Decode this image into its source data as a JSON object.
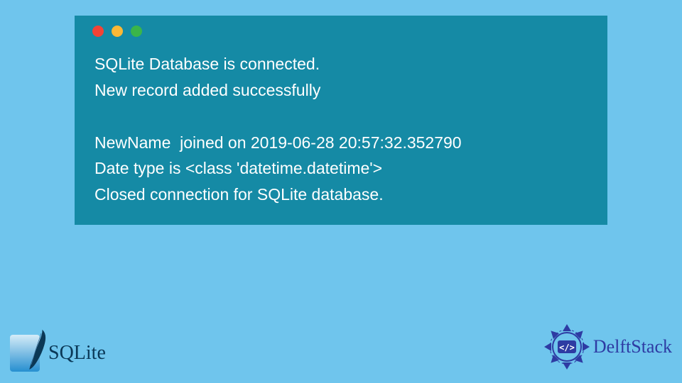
{
  "terminal": {
    "lines": [
      "SQLite Database is connected.",
      "New record added successfully",
      "",
      "NewName  joined on 2019-06-28 20:57:32.352790",
      "Date type is <class 'datetime.datetime'>",
      "Closed connection for SQLite database."
    ]
  },
  "logos": {
    "sqlite": "SQLite",
    "delftstack": "DelftStack"
  },
  "colors": {
    "page_bg": "#6fc5ed",
    "terminal_bg": "#158aa5",
    "dot_red": "#f44336",
    "dot_yellow": "#fdb835",
    "dot_green": "#3ab54a",
    "delft_accent": "#2e3ba3",
    "sqlite_text": "#0a3857"
  }
}
